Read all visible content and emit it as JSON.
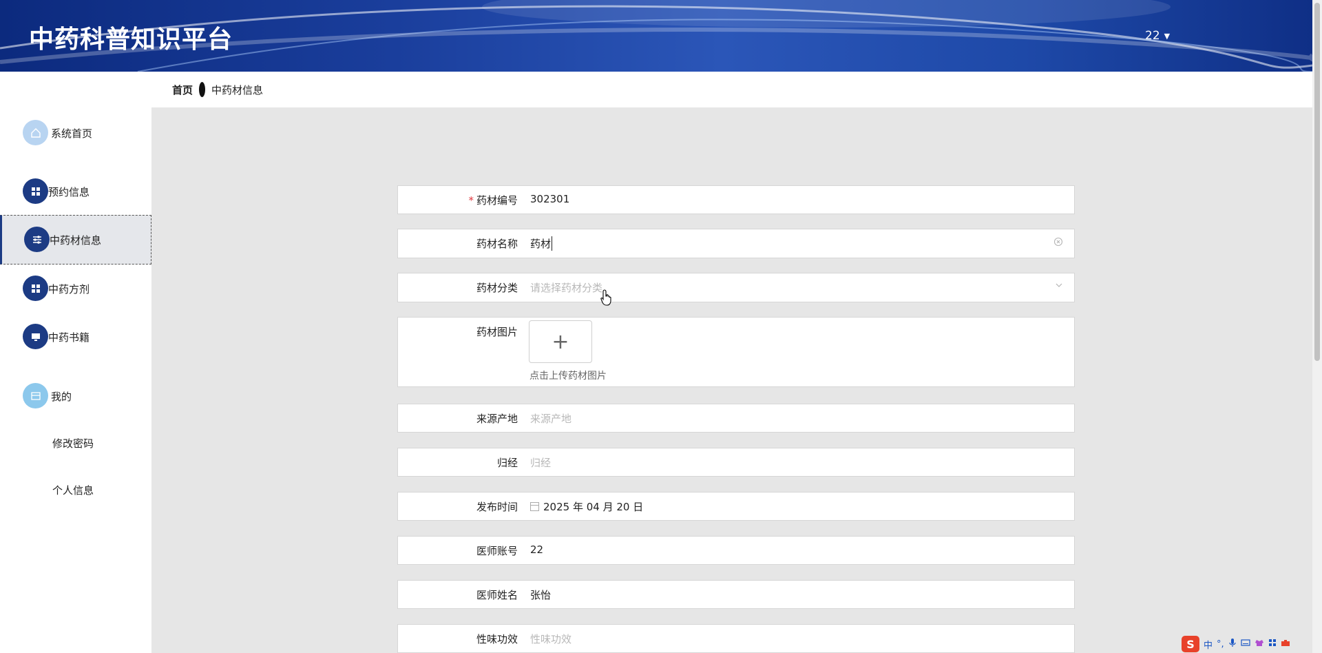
{
  "header": {
    "title": "中药科普知识平台",
    "user": "22",
    "caret": "▼"
  },
  "breadcrumb": {
    "home": "首页",
    "current": "中药材信息"
  },
  "sidebar": {
    "items": [
      {
        "label": "系统首页",
        "icon": "home-icon"
      },
      {
        "label": "预约信息",
        "icon": "grid-icon"
      },
      {
        "label": "中药材信息",
        "icon": "sliders-icon"
      },
      {
        "label": "中药方剂",
        "icon": "grid-icon"
      },
      {
        "label": "中药书籍",
        "icon": "monitor-icon"
      },
      {
        "label": "我的",
        "icon": "card-icon"
      }
    ],
    "sub_items": [
      {
        "label": "修改密码"
      },
      {
        "label": "个人信息"
      }
    ]
  },
  "form": {
    "code": {
      "label": "药材编号",
      "required": "*",
      "value": "302301"
    },
    "name": {
      "label": "药材名称",
      "value": "药材"
    },
    "category": {
      "label": "药材分类",
      "placeholder": "请选择药材分类"
    },
    "image": {
      "label": "药材图片",
      "upload_plus": "+",
      "tip": "点击上传药材图片"
    },
    "origin": {
      "label": "来源产地",
      "placeholder": "来源产地"
    },
    "meridian": {
      "label": "归经",
      "placeholder": "归经"
    },
    "publish_time": {
      "label": "发布时间",
      "value": "2025 年 04 月 20 日"
    },
    "doctor_account": {
      "label": "医师账号",
      "value": "22"
    },
    "doctor_name": {
      "label": "医师姓名",
      "value": "张怡"
    },
    "efficacy": {
      "label": "性味功效",
      "placeholder": "性味功效"
    }
  },
  "ime": {
    "logo": "S",
    "mode": "中",
    "punct": "°,"
  }
}
